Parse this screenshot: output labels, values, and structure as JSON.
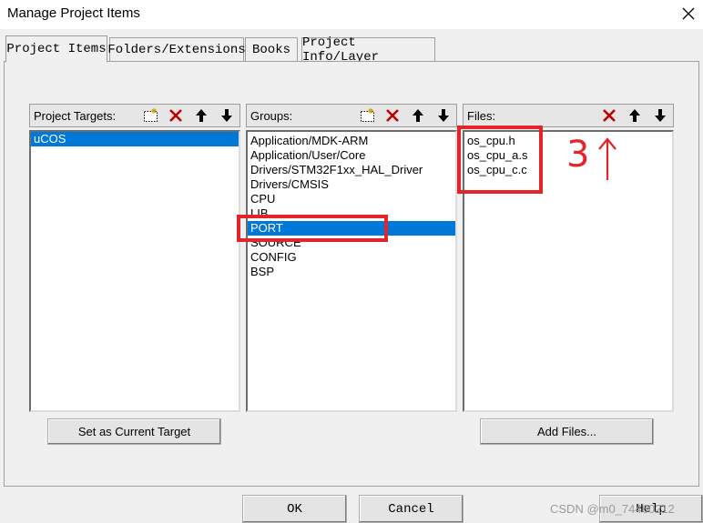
{
  "window": {
    "title": "Manage Project Items",
    "close_icon": "close-icon"
  },
  "tabs": [
    {
      "label": "Project Items",
      "active": true
    },
    {
      "label": "Folders/Extensions",
      "active": false
    },
    {
      "label": "Books",
      "active": false
    },
    {
      "label": "Project Info/Layer",
      "active": false
    }
  ],
  "targets": {
    "header": "Project Targets:",
    "items": [
      "uCOS"
    ],
    "selected_index": 0,
    "set_current_label": "Set as Current Target"
  },
  "groups": {
    "header": "Groups:",
    "items": [
      "Application/MDK-ARM",
      "Application/User/Core",
      "Drivers/STM32F1xx_HAL_Driver",
      "Drivers/CMSIS",
      "CPU",
      "LIB",
      "PORT",
      "SOURCE",
      "CONFIG",
      "BSP"
    ],
    "selected_index": 6
  },
  "files": {
    "header": "Files:",
    "items": [
      "os_cpu.h",
      "os_cpu_a.s",
      "os_cpu_c.c"
    ],
    "add_label": "Add Files..."
  },
  "buttons": {
    "ok": "OK",
    "cancel": "Cancel",
    "help": "Help"
  },
  "annotation": {
    "text": "3",
    "color": "#e3242b"
  },
  "watermark": "CSDN @m0_74460212",
  "colors": {
    "selection": "#0078d7",
    "highlight_box": "#e3242b",
    "dialog_bg": "#f0f0f0"
  }
}
